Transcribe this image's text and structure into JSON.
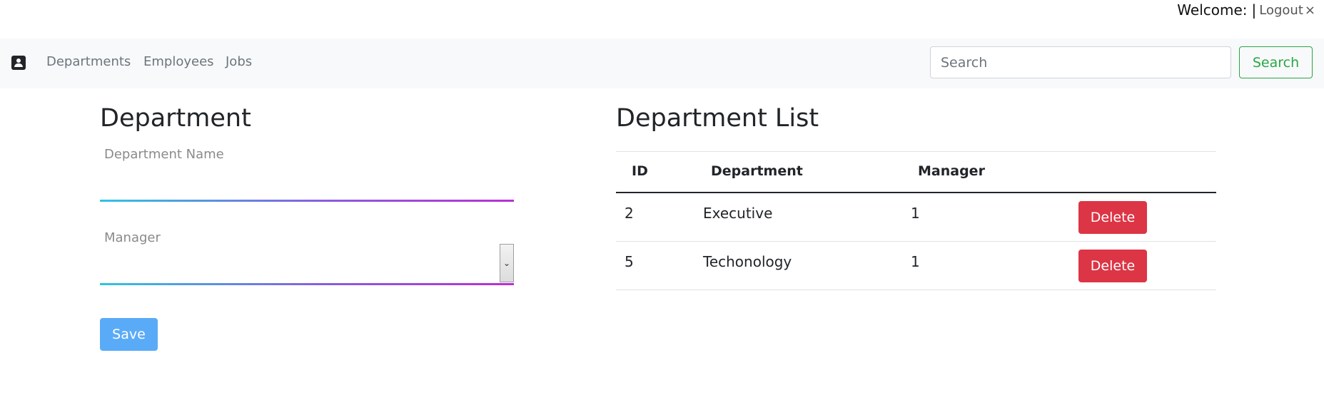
{
  "header": {
    "welcome_text": "Welcome:",
    "separator": "|",
    "logout_label": "Logout",
    "logout_icon_glyph": "×"
  },
  "navbar": {
    "brand_icon": "user-badge-icon",
    "links": [
      "Departments",
      "Employees",
      "Jobs"
    ],
    "search_placeholder": "Search",
    "search_button_label": "Search"
  },
  "form": {
    "title": "Department",
    "department_name_label": "Department Name",
    "department_name_value": "",
    "manager_label": "Manager",
    "manager_selected": "",
    "save_label": "Save"
  },
  "list": {
    "title": "Department List",
    "columns": [
      "ID",
      "Department",
      "Manager"
    ],
    "rows": [
      {
        "id": "2",
        "department": "Executive",
        "manager": "1",
        "action": "Delete"
      },
      {
        "id": "5",
        "department": "Techonology",
        "manager": "1",
        "action": "Delete"
      }
    ]
  },
  "colors": {
    "search_button": "#28a745",
    "save_button": "#5aabf7",
    "delete_button": "#dc3545",
    "input_underline_start": "#2fc4e3",
    "input_underline_end": "#b92fd6"
  }
}
